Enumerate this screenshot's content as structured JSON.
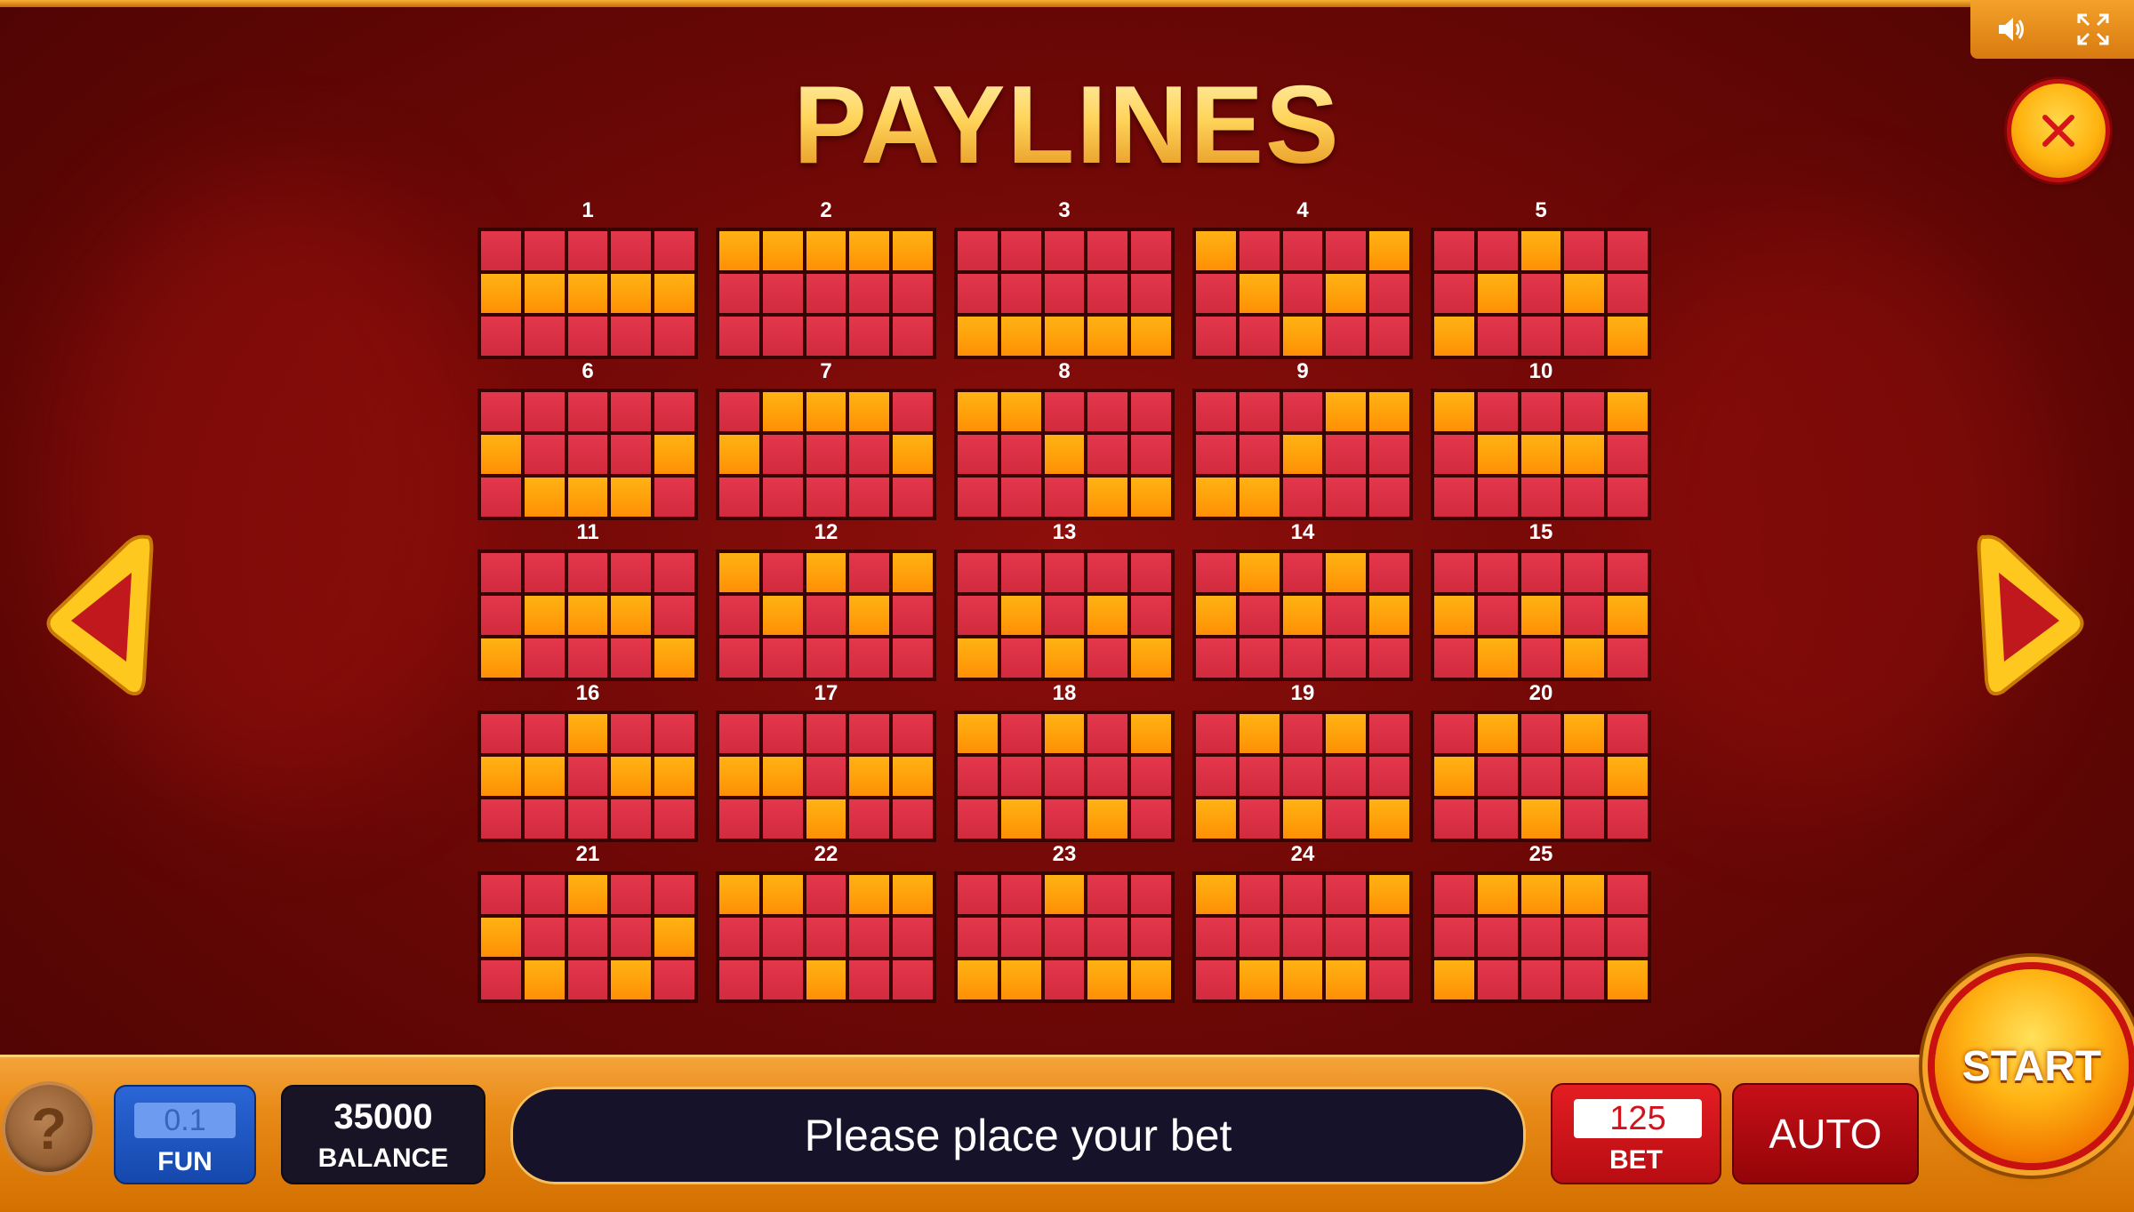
{
  "title": "PAYLINES",
  "top_controls": {
    "sound_icon": "speaker-icon",
    "fullscreen_icon": "fullscreen-icon"
  },
  "colors": {
    "background": "#6e0806",
    "cell_off": "#d22a3e",
    "cell_on": "#ffa20b",
    "accent": "#f4a33a"
  },
  "paylines": [
    {
      "number": "1",
      "pattern": [
        1,
        1,
        1,
        1,
        1
      ]
    },
    {
      "number": "2",
      "pattern": [
        0,
        0,
        0,
        0,
        0
      ]
    },
    {
      "number": "3",
      "pattern": [
        2,
        2,
        2,
        2,
        2
      ]
    },
    {
      "number": "4",
      "pattern": [
        0,
        1,
        2,
        1,
        0
      ]
    },
    {
      "number": "5",
      "pattern": [
        2,
        1,
        0,
        1,
        2
      ]
    },
    {
      "number": "6",
      "pattern": [
        1,
        2,
        2,
        2,
        1
      ]
    },
    {
      "number": "7",
      "pattern": [
        1,
        0,
        0,
        0,
        1
      ]
    },
    {
      "number": "8",
      "pattern": [
        0,
        0,
        1,
        2,
        2
      ]
    },
    {
      "number": "9",
      "pattern": [
        2,
        2,
        1,
        0,
        0
      ]
    },
    {
      "number": "10",
      "pattern": [
        0,
        1,
        1,
        1,
        0
      ]
    },
    {
      "number": "11",
      "pattern": [
        2,
        1,
        1,
        1,
        2
      ]
    },
    {
      "number": "12",
      "pattern": [
        0,
        1,
        0,
        1,
        0
      ]
    },
    {
      "number": "13",
      "pattern": [
        2,
        1,
        2,
        1,
        2
      ]
    },
    {
      "number": "14",
      "pattern": [
        1,
        0,
        1,
        0,
        1
      ]
    },
    {
      "number": "15",
      "pattern": [
        1,
        2,
        1,
        2,
        1
      ]
    },
    {
      "number": "16",
      "pattern": [
        1,
        1,
        0,
        1,
        1
      ]
    },
    {
      "number": "17",
      "pattern": [
        1,
        1,
        2,
        1,
        1
      ]
    },
    {
      "number": "18",
      "pattern": [
        0,
        2,
        0,
        2,
        0
      ]
    },
    {
      "number": "19",
      "pattern": [
        2,
        0,
        2,
        0,
        2
      ]
    },
    {
      "number": "20",
      "pattern": [
        1,
        0,
        2,
        0,
        1
      ]
    },
    {
      "number": "21",
      "pattern": [
        1,
        2,
        0,
        2,
        1
      ]
    },
    {
      "number": "22",
      "pattern": [
        0,
        0,
        2,
        0,
        0
      ]
    },
    {
      "number": "23",
      "pattern": [
        2,
        2,
        0,
        2,
        2
      ]
    },
    {
      "number": "24",
      "pattern": [
        0,
        2,
        2,
        2,
        0
      ]
    },
    {
      "number": "25",
      "pattern": [
        2,
        0,
        0,
        0,
        2
      ]
    }
  ],
  "bottom": {
    "help_label": "?",
    "fun_value": "0.1",
    "fun_label": "FUN",
    "balance_value": "35000",
    "balance_label": "BALANCE",
    "message": "Please place your bet",
    "bet_value": "125",
    "bet_label": "BET",
    "auto_label": "AUTO",
    "start_label": "START"
  }
}
